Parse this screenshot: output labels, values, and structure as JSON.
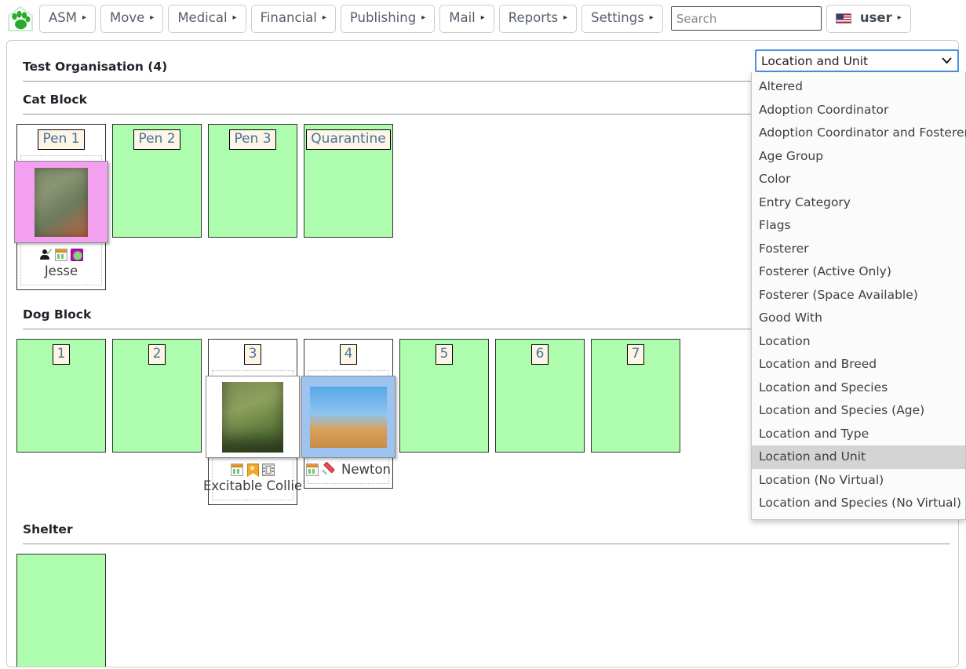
{
  "topnav": {
    "logo_icon": "paw-house-logo",
    "menus": [
      {
        "label": "ASM",
        "caret": "▸"
      },
      {
        "label": "Move",
        "caret": "▸"
      },
      {
        "label": "Medical",
        "caret": "▸"
      },
      {
        "label": "Financial",
        "caret": "▸"
      },
      {
        "label": "Publishing",
        "caret": "▸"
      },
      {
        "label": "Mail",
        "caret": "▸"
      },
      {
        "label": "Reports",
        "caret": "▸"
      },
      {
        "label": "Settings",
        "caret": "▸"
      }
    ],
    "search": {
      "value": "",
      "placeholder": "Search",
      "icon": "search-input"
    },
    "user": {
      "label": "user",
      "caret": "▸",
      "flag_icon": "us-flag-icon"
    }
  },
  "page": {
    "org_title": "Test Organisation (4)"
  },
  "view_select": {
    "value": "Location and Unit",
    "chevron": "⌄",
    "options": [
      "Altered",
      "Adoption Coordinator",
      "Adoption Coordinator and Fosterer",
      "Age Group",
      "Color",
      "Entry Category",
      "Flags",
      "Fosterer",
      "Fosterer (Active Only)",
      "Fosterer (Space Available)",
      "Good With",
      "Location",
      "Location and Breed",
      "Location and Species",
      "Location and Species (Age)",
      "Location and Type",
      "Location and Unit",
      "Location (No Virtual)",
      "Location and Species (No Virtual)"
    ],
    "selected_index": 16
  },
  "sections": [
    {
      "title": "Cat Block",
      "units": [
        {
          "label": "Pen 1",
          "occupied": true,
          "animal": {
            "name": "Jesse",
            "name_position": "below",
            "frame_color": "#f3a0f0",
            "thumb_bg": "#f3a0f0",
            "icons": [
              "person-check-icon",
              "record-calendar-icon",
              "flag-circle-icon"
            ]
          }
        },
        {
          "label": "Pen 2",
          "occupied": false
        },
        {
          "label": "Pen 3",
          "occupied": false
        },
        {
          "label": "Quarantine",
          "occupied": false
        }
      ]
    },
    {
      "title": "Dog Block",
      "units": [
        {
          "label": "1",
          "occupied": false
        },
        {
          "label": "2",
          "occupied": false
        },
        {
          "label": "3",
          "occupied": true,
          "animal": {
            "name": "Excitable Collie",
            "name_position": "below",
            "frame_color": "#ffffff",
            "thumb_bg": "#ffffff",
            "icons": [
              "record-calendar-icon",
              "star-bookmark-icon",
              "filmstrip-icon"
            ]
          }
        },
        {
          "label": "4",
          "occupied": true,
          "animal": {
            "name": "Newton",
            "name_position": "inline",
            "frame_color": "#9dc3f0",
            "thumb_bg": "#9dc3f0",
            "icons": [
              "record-calendar-icon",
              "syringe-icon"
            ]
          }
        },
        {
          "label": "5",
          "occupied": false
        },
        {
          "label": "6",
          "occupied": false
        },
        {
          "label": "7",
          "occupied": false
        }
      ]
    },
    {
      "title": "Shelter",
      "units": [
        {
          "label": "",
          "occupied": false
        }
      ]
    }
  ],
  "colors": {
    "empty_unit": "#aefcae",
    "unit_border": "#333333",
    "label_bg": "#fdf5e6",
    "label_text": "#4a7296",
    "select_focus": "#4a90e2",
    "option_selected_bg": "#d4d4d4"
  }
}
